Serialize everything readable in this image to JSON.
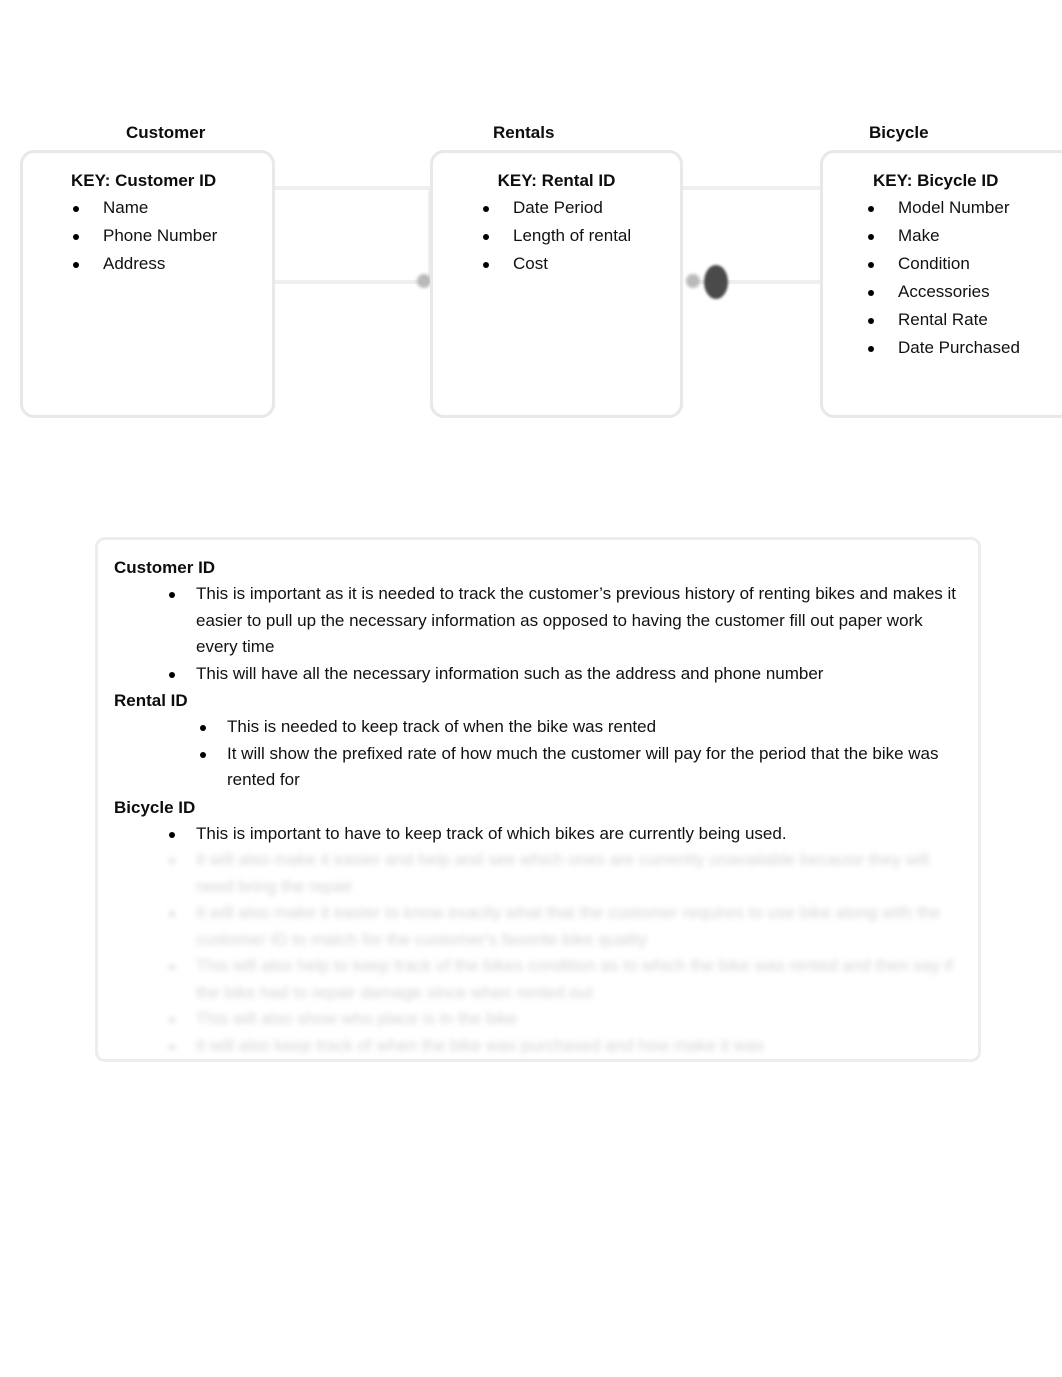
{
  "document": {
    "type": "entity-relationship-diagram-document"
  },
  "erd": {
    "entities": [
      {
        "title": "Customer",
        "key_label": "KEY: Customer ID",
        "attributes": [
          "Name",
          "Phone Number",
          "Address"
        ]
      },
      {
        "title": "Rentals",
        "key_label": "KEY: Rental ID",
        "attributes": [
          "Date Period",
          "Length of rental",
          "Cost"
        ]
      },
      {
        "title": "Bicycle",
        "key_label": "KEY: Bicycle ID",
        "attributes": [
          "Model Number",
          "Make",
          "Condition",
          "Accessories",
          "Rental Rate",
          "Date Purchased"
        ]
      }
    ],
    "relationships": [
      {
        "from": "Customer",
        "to": "Rentals"
      },
      {
        "from": "Rentals",
        "to": "Bicycle"
      }
    ]
  },
  "notes": {
    "sections": [
      {
        "heading": "Customer ID",
        "indent": "a",
        "bullets": [
          "This is important as it is needed to track the customer’s previous history of renting bikes and makes it easier to pull up the necessary information as opposed to having the customer fill out paper work every time",
          "This will have all the necessary information such as the address and phone number"
        ]
      },
      {
        "heading": "Rental ID",
        "indent": "b",
        "bullets": [
          "This is needed to keep track of when the bike was rented",
          "It will show the prefixed rate of how much the customer will pay for the period that the bike was rented for"
        ]
      },
      {
        "heading": "Bicycle ID",
        "indent": "a",
        "bullets": [
          "This is important to have to keep track of which bikes are currently being used."
        ]
      }
    ],
    "faded_bullets": [
      "It will also make it easier and help and see which ones are currently unavailable because they will need bring the repair",
      "It will also make it easier to know exactly what that the customer requires to use bike along with the customer ID to match for the customer's favorite bike quality",
      "This will also help to keep track of the bikes condition as to which the bike was rented and then say if the bike had to repair damage since when rented out",
      "This will also show who place is in the bike",
      "It will also keep track of when the bike was purchased and how make it was"
    ]
  },
  "colors": {
    "box_border": "#ededed",
    "entity_border": "#e8e8e8",
    "text": "#111111",
    "faded_text": "#d6d6d6",
    "connector": "#efefef",
    "connector_dot": "#4a4a4a"
  }
}
